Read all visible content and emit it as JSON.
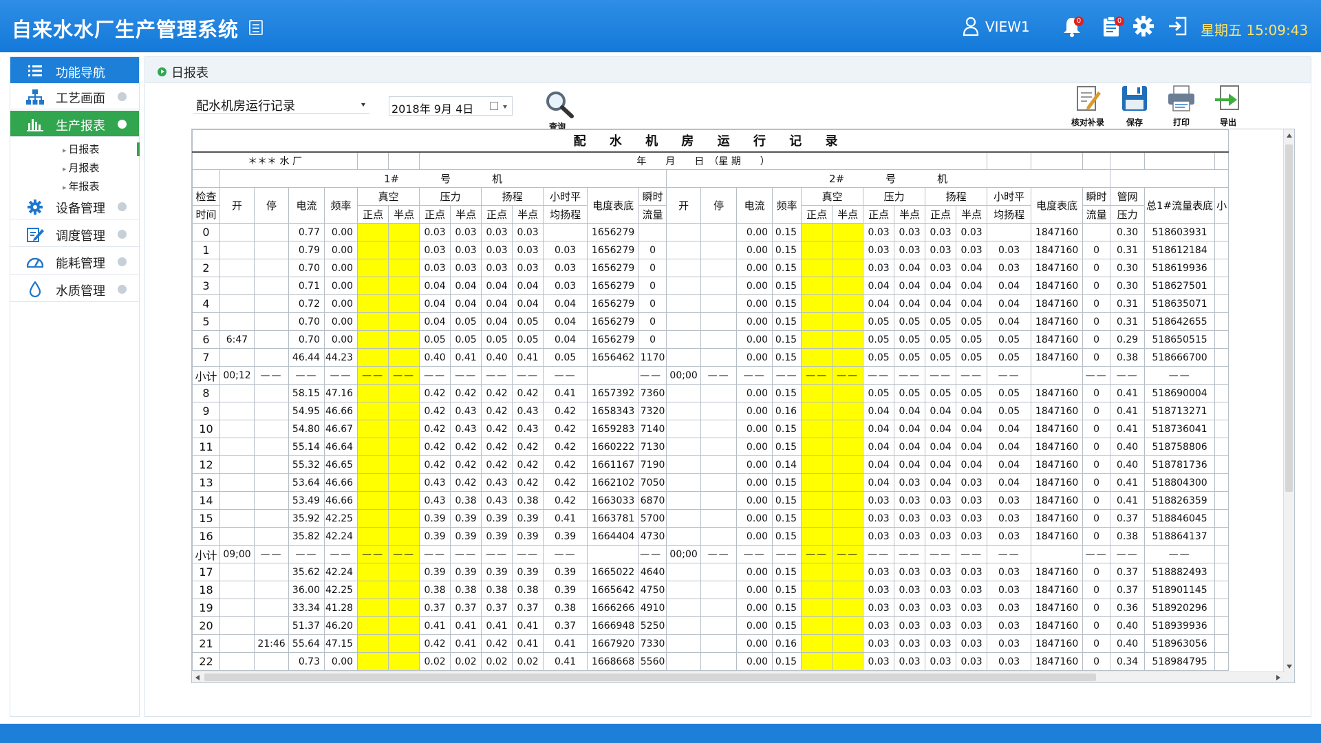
{
  "header": {
    "title": "自来水水厂生产管理系统",
    "user": "VIEW1",
    "bell_count": "0",
    "clip_count": "0",
    "clock": "星期五 15:09:43"
  },
  "sidebar": {
    "head": "功能导航",
    "items": [
      {
        "label": "工艺画面"
      },
      {
        "label": "生产报表"
      },
      {
        "label": "设备管理"
      },
      {
        "label": "调度管理"
      },
      {
        "label": "能耗管理"
      },
      {
        "label": "水质管理"
      }
    ],
    "sub_items": [
      {
        "label": "日报表"
      },
      {
        "label": "月报表"
      },
      {
        "label": "年报表"
      }
    ]
  },
  "breadcrumb": "日报表",
  "filters": {
    "report": "配水机房运行记录",
    "date": "2018年 9月 4日"
  },
  "toolbar": {
    "search": "查询",
    "check": "核对补录",
    "save": "保存",
    "print": "打印",
    "export": "导出"
  },
  "report": {
    "title": "配 水 机 房 运 行 记 录",
    "plant": "＊＊＊ 水 厂",
    "date_line": "年　　月　　日　（星 期　　）",
    "pump1": "1#　　　　号　　　　机",
    "pump2": "2#　　　　号　　　　机",
    "headers": {
      "time_top": "检查",
      "time_bot": "时间",
      "start": "开",
      "stop": "停",
      "current": "电流",
      "freq": "频率",
      "vacuum": "真空",
      "pressure": "压力",
      "head": "扬程",
      "hourly_top": "小时平",
      "hourly_bot": "均扬程",
      "meter": "电度表底",
      "flow_top": "瞬时",
      "flow_bot": "流量",
      "point": "正点",
      "half": "半点",
      "net_top": "管网",
      "net_bot": "压力",
      "total": "总1#流量表底",
      "extra": "小"
    },
    "rows": [
      {
        "h": "0",
        "s1": "",
        "e1": "",
        "i1": "0.77",
        "f1": "0.00",
        "pp": "0.03",
        "ph": "0.03",
        "hp": "0.03",
        "hh": "0.03",
        "avg": "",
        "m1": "1656279",
        "fl1": "",
        "s2": "",
        "e2": "",
        "i2": "0.00",
        "f2": "0.15",
        "pp2": "0.03",
        "ph2": "0.03",
        "hp2": "0.03",
        "hh2": "0.03",
        "avg2": "",
        "m2": "1847160",
        "fl2": "",
        "np": "0.30",
        "tot": "518603931"
      },
      {
        "h": "1",
        "s1": "",
        "e1": "",
        "i1": "0.79",
        "f1": "0.00",
        "pp": "0.03",
        "ph": "0.03",
        "hp": "0.03",
        "hh": "0.03",
        "avg": "0.03",
        "m1": "1656279",
        "fl1": "0",
        "s2": "",
        "e2": "",
        "i2": "0.00",
        "f2": "0.15",
        "pp2": "0.03",
        "ph2": "0.03",
        "hp2": "0.03",
        "hh2": "0.03",
        "avg2": "0.03",
        "m2": "1847160",
        "fl2": "0",
        "np": "0.31",
        "tot": "518612184"
      },
      {
        "h": "2",
        "s1": "",
        "e1": "",
        "i1": "0.70",
        "f1": "0.00",
        "pp": "0.03",
        "ph": "0.03",
        "hp": "0.03",
        "hh": "0.03",
        "avg": "0.03",
        "m1": "1656279",
        "fl1": "0",
        "s2": "",
        "e2": "",
        "i2": "0.00",
        "f2": "0.15",
        "pp2": "0.03",
        "ph2": "0.04",
        "hp2": "0.03",
        "hh2": "0.04",
        "avg2": "0.03",
        "m2": "1847160",
        "fl2": "0",
        "np": "0.30",
        "tot": "518619936"
      },
      {
        "h": "3",
        "s1": "",
        "e1": "",
        "i1": "0.71",
        "f1": "0.00",
        "pp": "0.04",
        "ph": "0.04",
        "hp": "0.04",
        "hh": "0.04",
        "avg": "0.03",
        "m1": "1656279",
        "fl1": "0",
        "s2": "",
        "e2": "",
        "i2": "0.00",
        "f2": "0.15",
        "pp2": "0.04",
        "ph2": "0.04",
        "hp2": "0.04",
        "hh2": "0.04",
        "avg2": "0.04",
        "m2": "1847160",
        "fl2": "0",
        "np": "0.30",
        "tot": "518627501"
      },
      {
        "h": "4",
        "s1": "",
        "e1": "",
        "i1": "0.72",
        "f1": "0.00",
        "pp": "0.04",
        "ph": "0.04",
        "hp": "0.04",
        "hh": "0.04",
        "avg": "0.04",
        "m1": "1656279",
        "fl1": "0",
        "s2": "",
        "e2": "",
        "i2": "0.00",
        "f2": "0.15",
        "pp2": "0.04",
        "ph2": "0.04",
        "hp2": "0.04",
        "hh2": "0.04",
        "avg2": "0.04",
        "m2": "1847160",
        "fl2": "0",
        "np": "0.31",
        "tot": "518635071"
      },
      {
        "h": "5",
        "s1": "",
        "e1": "",
        "i1": "0.70",
        "f1": "0.00",
        "pp": "0.04",
        "ph": "0.05",
        "hp": "0.04",
        "hh": "0.05",
        "avg": "0.04",
        "m1": "1656279",
        "fl1": "0",
        "s2": "",
        "e2": "",
        "i2": "0.00",
        "f2": "0.15",
        "pp2": "0.05",
        "ph2": "0.05",
        "hp2": "0.05",
        "hh2": "0.05",
        "avg2": "0.04",
        "m2": "1847160",
        "fl2": "0",
        "np": "0.31",
        "tot": "518642655"
      },
      {
        "h": "6",
        "s1": "6:47",
        "e1": "",
        "i1": "0.70",
        "f1": "0.00",
        "pp": "0.05",
        "ph": "0.05",
        "hp": "0.05",
        "hh": "0.05",
        "avg": "0.04",
        "m1": "1656279",
        "fl1": "0",
        "s2": "",
        "e2": "",
        "i2": "0.00",
        "f2": "0.15",
        "pp2": "0.05",
        "ph2": "0.05",
        "hp2": "0.05",
        "hh2": "0.05",
        "avg2": "0.05",
        "m2": "1847160",
        "fl2": "0",
        "np": "0.29",
        "tot": "518650515"
      },
      {
        "h": "7",
        "s1": "",
        "e1": "",
        "i1": "46.44",
        "f1": "44.23",
        "pp": "0.40",
        "ph": "0.41",
        "hp": "0.40",
        "hh": "0.41",
        "avg": "0.05",
        "m1": "1656462",
        "fl1": "1170",
        "s2": "",
        "e2": "",
        "i2": "0.00",
        "f2": "0.15",
        "pp2": "0.05",
        "ph2": "0.05",
        "hp2": "0.05",
        "hh2": "0.05",
        "avg2": "0.05",
        "m2": "1847160",
        "fl2": "0",
        "np": "0.38",
        "tot": "518666700"
      },
      {
        "sub": true,
        "h": "小计",
        "s1": "00;12",
        "s2": "00;00",
        "d": "——"
      },
      {
        "h": "8",
        "s1": "",
        "e1": "",
        "i1": "58.15",
        "f1": "47.16",
        "pp": "0.42",
        "ph": "0.42",
        "hp": "0.42",
        "hh": "0.42",
        "avg": "0.41",
        "m1": "1657392",
        "fl1": "7360",
        "s2": "",
        "e2": "",
        "i2": "0.00",
        "f2": "0.15",
        "pp2": "0.05",
        "ph2": "0.05",
        "hp2": "0.05",
        "hh2": "0.05",
        "avg2": "0.05",
        "m2": "1847160",
        "fl2": "0",
        "np": "0.41",
        "tot": "518690004"
      },
      {
        "h": "9",
        "s1": "",
        "e1": "",
        "i1": "54.95",
        "f1": "46.66",
        "pp": "0.42",
        "ph": "0.43",
        "hp": "0.42",
        "hh": "0.43",
        "avg": "0.42",
        "m1": "1658343",
        "fl1": "7320",
        "s2": "",
        "e2": "",
        "i2": "0.00",
        "f2": "0.16",
        "pp2": "0.04",
        "ph2": "0.04",
        "hp2": "0.04",
        "hh2": "0.04",
        "avg2": "0.05",
        "m2": "1847160",
        "fl2": "0",
        "np": "0.41",
        "tot": "518713271"
      },
      {
        "h": "10",
        "s1": "",
        "e1": "",
        "i1": "54.80",
        "f1": "46.67",
        "pp": "0.42",
        "ph": "0.43",
        "hp": "0.42",
        "hh": "0.43",
        "avg": "0.42",
        "m1": "1659283",
        "fl1": "7140",
        "s2": "",
        "e2": "",
        "i2": "0.00",
        "f2": "0.15",
        "pp2": "0.04",
        "ph2": "0.04",
        "hp2": "0.04",
        "hh2": "0.04",
        "avg2": "0.04",
        "m2": "1847160",
        "fl2": "0",
        "np": "0.41",
        "tot": "518736041"
      },
      {
        "h": "11",
        "s1": "",
        "e1": "",
        "i1": "55.14",
        "f1": "46.64",
        "pp": "0.42",
        "ph": "0.42",
        "hp": "0.42",
        "hh": "0.42",
        "avg": "0.42",
        "m1": "1660222",
        "fl1": "7130",
        "s2": "",
        "e2": "",
        "i2": "0.00",
        "f2": "0.15",
        "pp2": "0.04",
        "ph2": "0.04",
        "hp2": "0.04",
        "hh2": "0.04",
        "avg2": "0.04",
        "m2": "1847160",
        "fl2": "0",
        "np": "0.40",
        "tot": "518758806"
      },
      {
        "h": "12",
        "s1": "",
        "e1": "",
        "i1": "55.32",
        "f1": "46.65",
        "pp": "0.42",
        "ph": "0.42",
        "hp": "0.42",
        "hh": "0.42",
        "avg": "0.42",
        "m1": "1661167",
        "fl1": "7190",
        "s2": "",
        "e2": "",
        "i2": "0.00",
        "f2": "0.14",
        "pp2": "0.04",
        "ph2": "0.04",
        "hp2": "0.04",
        "hh2": "0.04",
        "avg2": "0.04",
        "m2": "1847160",
        "fl2": "0",
        "np": "0.40",
        "tot": "518781736"
      },
      {
        "h": "13",
        "s1": "",
        "e1": "",
        "i1": "53.64",
        "f1": "46.66",
        "pp": "0.43",
        "ph": "0.42",
        "hp": "0.43",
        "hh": "0.42",
        "avg": "0.42",
        "m1": "1662102",
        "fl1": "7050",
        "s2": "",
        "e2": "",
        "i2": "0.00",
        "f2": "0.15",
        "pp2": "0.04",
        "ph2": "0.03",
        "hp2": "0.04",
        "hh2": "0.03",
        "avg2": "0.04",
        "m2": "1847160",
        "fl2": "0",
        "np": "0.41",
        "tot": "518804300"
      },
      {
        "h": "14",
        "s1": "",
        "e1": "",
        "i1": "53.49",
        "f1": "46.66",
        "pp": "0.43",
        "ph": "0.38",
        "hp": "0.43",
        "hh": "0.38",
        "avg": "0.42",
        "m1": "1663033",
        "fl1": "6870",
        "s2": "",
        "e2": "",
        "i2": "0.00",
        "f2": "0.15",
        "pp2": "0.03",
        "ph2": "0.03",
        "hp2": "0.03",
        "hh2": "0.03",
        "avg2": "0.03",
        "m2": "1847160",
        "fl2": "0",
        "np": "0.41",
        "tot": "518826359"
      },
      {
        "h": "15",
        "s1": "",
        "e1": "",
        "i1": "35.92",
        "f1": "42.25",
        "pp": "0.39",
        "ph": "0.39",
        "hp": "0.39",
        "hh": "0.39",
        "avg": "0.41",
        "m1": "1663781",
        "fl1": "5700",
        "s2": "",
        "e2": "",
        "i2": "0.00",
        "f2": "0.15",
        "pp2": "0.03",
        "ph2": "0.03",
        "hp2": "0.03",
        "hh2": "0.03",
        "avg2": "0.03",
        "m2": "1847160",
        "fl2": "0",
        "np": "0.37",
        "tot": "518846045"
      },
      {
        "h": "16",
        "s1": "",
        "e1": "",
        "i1": "35.82",
        "f1": "42.24",
        "pp": "0.39",
        "ph": "0.39",
        "hp": "0.39",
        "hh": "0.39",
        "avg": "0.39",
        "m1": "1664404",
        "fl1": "4730",
        "s2": "",
        "e2": "",
        "i2": "0.00",
        "f2": "0.15",
        "pp2": "0.03",
        "ph2": "0.03",
        "hp2": "0.03",
        "hh2": "0.03",
        "avg2": "0.03",
        "m2": "1847160",
        "fl2": "0",
        "np": "0.38",
        "tot": "518864137"
      },
      {
        "sub": true,
        "h": "小计",
        "s1": "09;00",
        "s2": "00;00",
        "d": "——"
      },
      {
        "h": "17",
        "s1": "",
        "e1": "",
        "i1": "35.62",
        "f1": "42.24",
        "pp": "0.39",
        "ph": "0.39",
        "hp": "0.39",
        "hh": "0.39",
        "avg": "0.39",
        "m1": "1665022",
        "fl1": "4640",
        "s2": "",
        "e2": "",
        "i2": "0.00",
        "f2": "0.15",
        "pp2": "0.03",
        "ph2": "0.03",
        "hp2": "0.03",
        "hh2": "0.03",
        "avg2": "0.03",
        "m2": "1847160",
        "fl2": "0",
        "np": "0.37",
        "tot": "518882493"
      },
      {
        "h": "18",
        "s1": "",
        "e1": "",
        "i1": "36.00",
        "f1": "42.25",
        "pp": "0.38",
        "ph": "0.38",
        "hp": "0.38",
        "hh": "0.38",
        "avg": "0.39",
        "m1": "1665642",
        "fl1": "4750",
        "s2": "",
        "e2": "",
        "i2": "0.00",
        "f2": "0.15",
        "pp2": "0.03",
        "ph2": "0.03",
        "hp2": "0.03",
        "hh2": "0.03",
        "avg2": "0.03",
        "m2": "1847160",
        "fl2": "0",
        "np": "0.37",
        "tot": "518901145"
      },
      {
        "h": "19",
        "s1": "",
        "e1": "",
        "i1": "33.34",
        "f1": "41.28",
        "pp": "0.37",
        "ph": "0.37",
        "hp": "0.37",
        "hh": "0.37",
        "avg": "0.38",
        "m1": "1666266",
        "fl1": "4910",
        "s2": "",
        "e2": "",
        "i2": "0.00",
        "f2": "0.15",
        "pp2": "0.03",
        "ph2": "0.03",
        "hp2": "0.03",
        "hh2": "0.03",
        "avg2": "0.03",
        "m2": "1847160",
        "fl2": "0",
        "np": "0.36",
        "tot": "518920296"
      },
      {
        "h": "20",
        "s1": "",
        "e1": "",
        "i1": "51.37",
        "f1": "46.20",
        "pp": "0.41",
        "ph": "0.41",
        "hp": "0.41",
        "hh": "0.41",
        "avg": "0.37",
        "m1": "1666948",
        "fl1": "5250",
        "s2": "",
        "e2": "",
        "i2": "0.00",
        "f2": "0.15",
        "pp2": "0.03",
        "ph2": "0.03",
        "hp2": "0.03",
        "hh2": "0.03",
        "avg2": "0.03",
        "m2": "1847160",
        "fl2": "0",
        "np": "0.40",
        "tot": "518939936"
      },
      {
        "h": "21",
        "s1": "",
        "e1": "21:46",
        "i1": "55.64",
        "f1": "47.15",
        "pp": "0.42",
        "ph": "0.41",
        "hp": "0.42",
        "hh": "0.41",
        "avg": "0.41",
        "m1": "1667920",
        "fl1": "7330",
        "s2": "",
        "e2": "",
        "i2": "0.00",
        "f2": "0.16",
        "pp2": "0.03",
        "ph2": "0.03",
        "hp2": "0.03",
        "hh2": "0.03",
        "avg2": "0.03",
        "m2": "1847160",
        "fl2": "0",
        "np": "0.40",
        "tot": "518963056"
      },
      {
        "h": "22",
        "s1": "",
        "e1": "",
        "i1": "0.73",
        "f1": "0.00",
        "pp": "0.02",
        "ph": "0.02",
        "hp": "0.02",
        "hh": "0.02",
        "avg": "0.41",
        "m1": "1668668",
        "fl1": "5560",
        "s2": "",
        "e2": "",
        "i2": "0.00",
        "f2": "0.15",
        "pp2": "0.03",
        "ph2": "0.03",
        "hp2": "0.03",
        "hh2": "0.03",
        "avg2": "0.03",
        "m2": "1847160",
        "fl2": "0",
        "np": "0.34",
        "tot": "518984795"
      }
    ]
  },
  "colors": {
    "header_blue": "#1e7fd8",
    "active_green": "#31a64e",
    "highlight_yellow": "#ffff00",
    "clock_yellow": "#ffe36a"
  }
}
